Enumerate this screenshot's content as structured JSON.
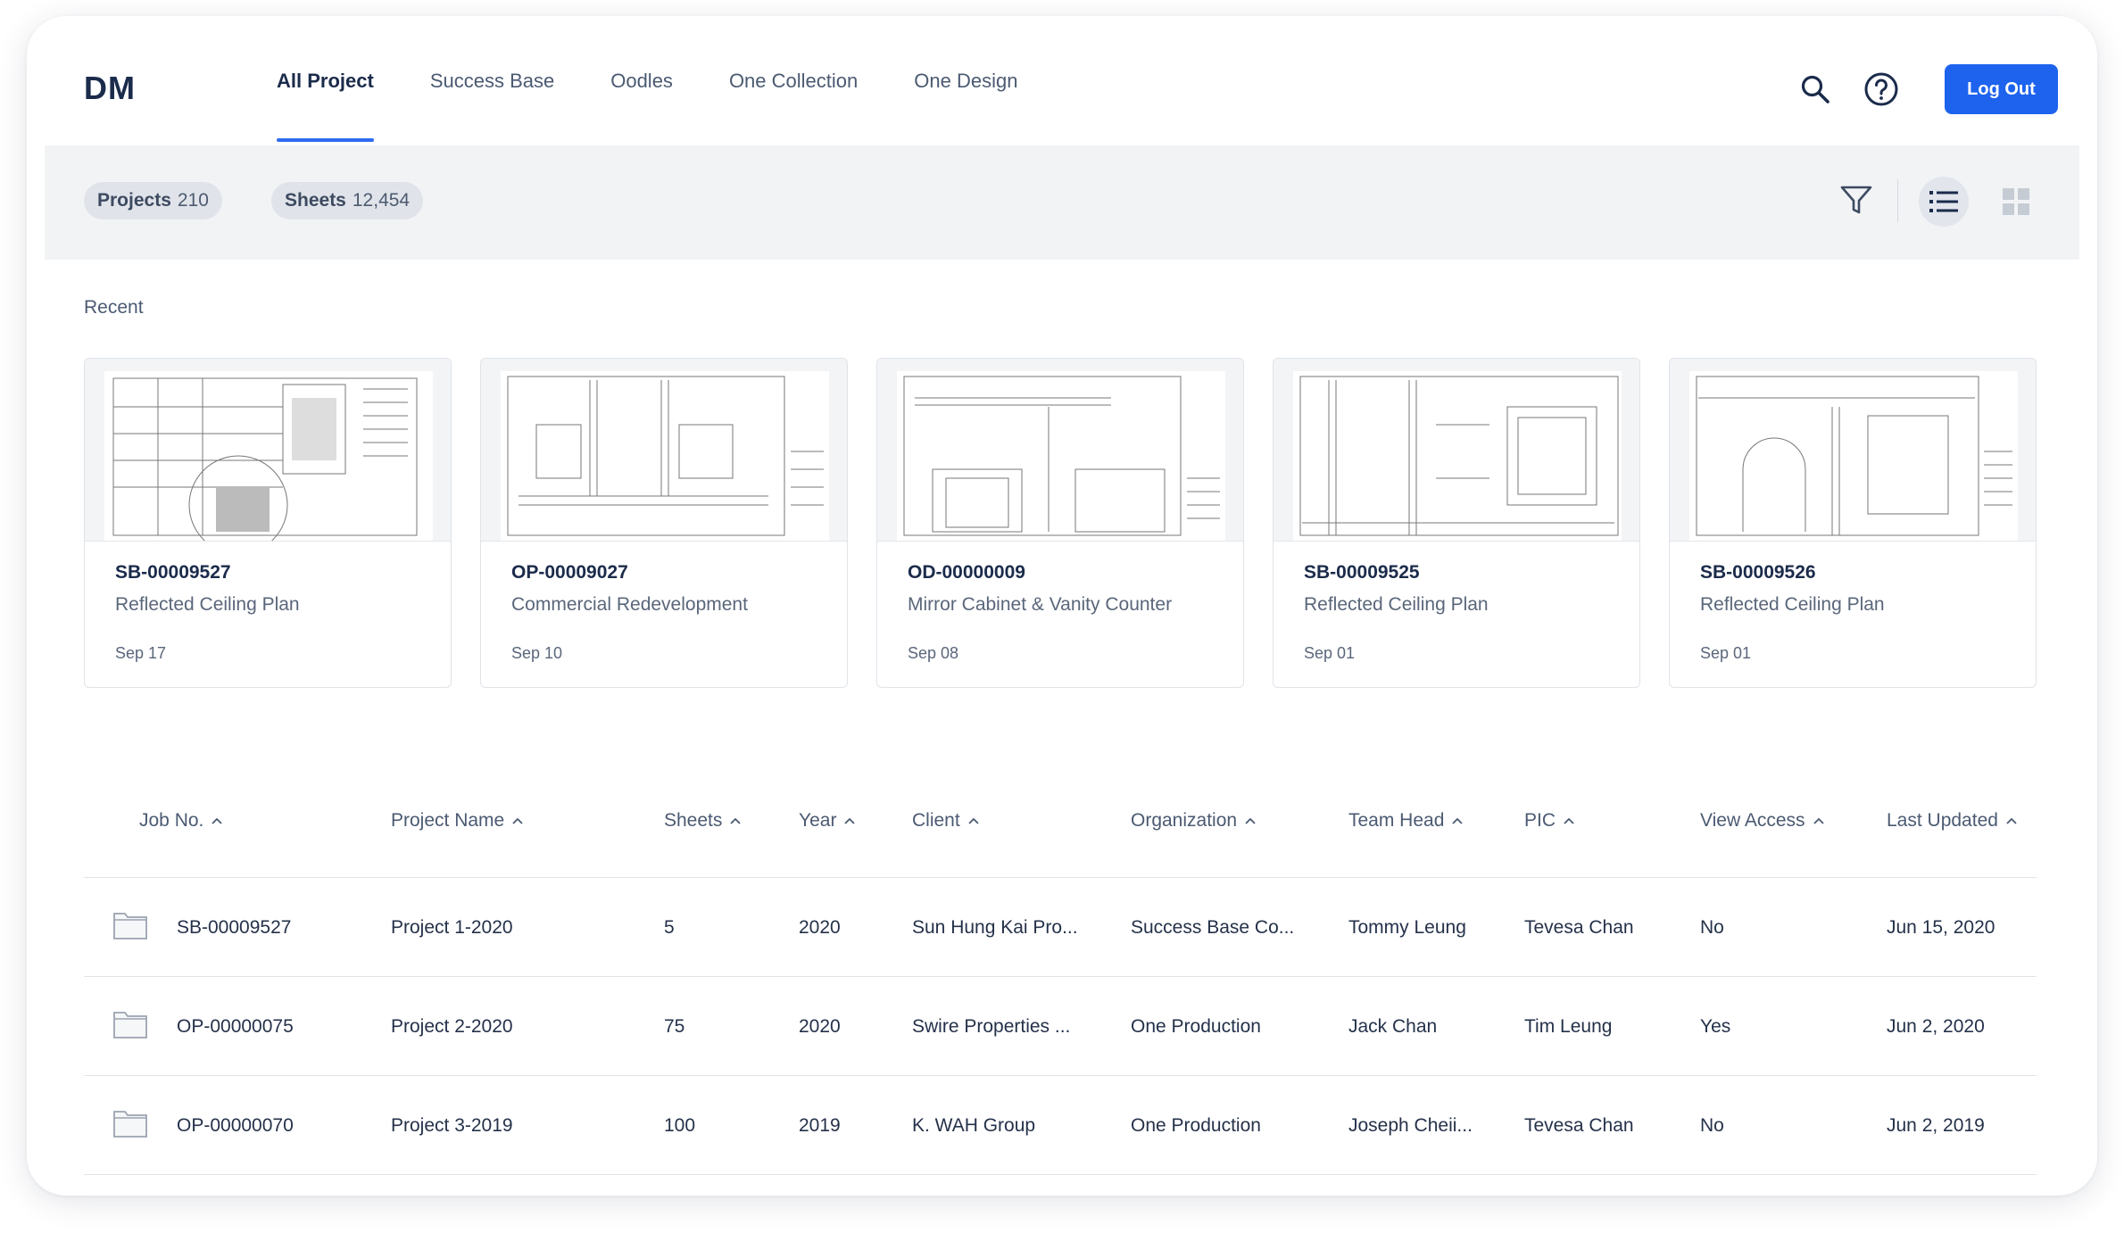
{
  "app": {
    "logo": "DM",
    "tabs": [
      {
        "label": "All Project",
        "active": true
      },
      {
        "label": "Success Base",
        "active": false
      },
      {
        "label": "Oodles",
        "active": false
      },
      {
        "label": "One Collection",
        "active": false
      },
      {
        "label": "One Design",
        "active": false
      }
    ],
    "search_icon": "search-icon",
    "help_icon": "help-icon",
    "logout_label": "Log Out",
    "accent": "#1d63ee"
  },
  "summary": {
    "projects_label": "Projects",
    "projects_count": "210",
    "sheets_label": "Sheets",
    "sheets_count": "12,454",
    "filter_icon": "filter-icon",
    "list_view_icon": "list-view-icon",
    "grid_view_icon": "grid-view-icon",
    "active_view": "list"
  },
  "recent": {
    "title": "Recent",
    "items": [
      {
        "code": "SB-00009527",
        "name": "Reflected Ceiling Plan",
        "date": "Sep 17"
      },
      {
        "code": "OP-00009027",
        "name": "Commercial Redevelopment",
        "date": "Sep 10"
      },
      {
        "code": "OD-00000009",
        "name": "Mirror Cabinet & Vanity Counter",
        "date": "Sep 08"
      },
      {
        "code": "SB-00009525",
        "name": "Reflected Ceiling Plan",
        "date": "Sep 01"
      },
      {
        "code": "SB-00009526",
        "name": "Reflected Ceiling Plan",
        "date": "Sep 01"
      }
    ]
  },
  "table": {
    "columns": [
      "Job No.",
      "Project Name",
      "Sheets",
      "Year",
      "Client",
      "Organization",
      "Team Head",
      "PIC",
      "View Access",
      "Last Updated"
    ],
    "rows": [
      [
        "SB-00009527",
        "Project 1-2020",
        "5",
        "2020",
        "Sun Hung Kai Pro...",
        "Success Base Co...",
        "Tommy Leung",
        "Tevesa Chan",
        "No",
        "Jun 15, 2020"
      ],
      [
        "OP-00000075",
        "Project 2-2020",
        "75",
        "2020",
        "Swire Properties ...",
        "One Production",
        "Jack Chan",
        "Tim Leung",
        "Yes",
        "Jun 2, 2020"
      ],
      [
        "OP-00000070",
        "Project 3-2019",
        "100",
        "2019",
        "K. WAH Group",
        "One Production",
        "Joseph Cheii...",
        "Tevesa Chan",
        "No",
        "Jun 2, 2019"
      ]
    ]
  }
}
